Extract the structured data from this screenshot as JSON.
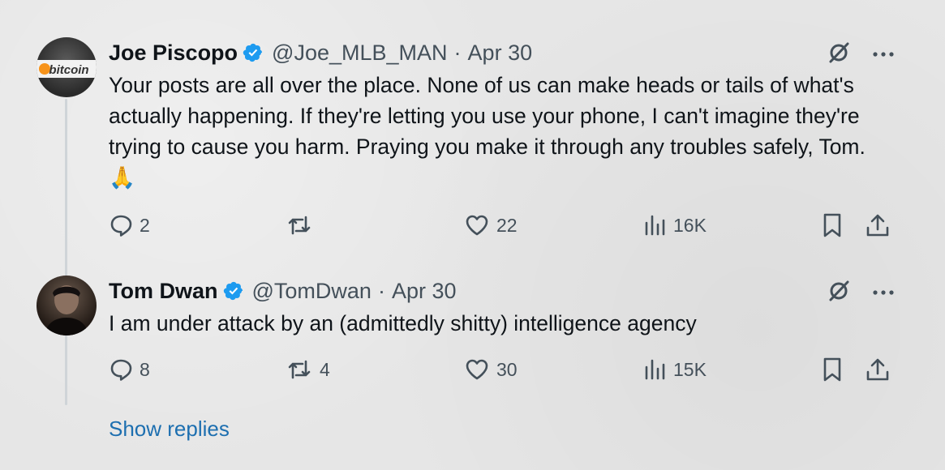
{
  "tweets": [
    {
      "author": {
        "name": "Joe Piscopo",
        "handle": "@Joe_MLB_MAN",
        "avatar_text": "bitcoin",
        "verified": true
      },
      "date": "Apr 30",
      "separator": "·",
      "text": "Your posts are all over the place. None of us can make heads or tails of what's actually happening. If they're letting you use your phone, I can't imagine they're trying to cause you harm. Praying you make it through any troubles safely, Tom. 🙏",
      "stats": {
        "replies": "2",
        "reposts": "",
        "likes": "22",
        "views": "16K"
      }
    },
    {
      "author": {
        "name": "Tom Dwan",
        "handle": "@TomDwan",
        "verified": true
      },
      "date": "Apr 30",
      "separator": "·",
      "text": "I am under attack by an (admittedly shitty) intelligence agency",
      "stats": {
        "replies": "8",
        "reposts": "4",
        "likes": "30",
        "views": "15K"
      }
    }
  ],
  "show_replies_label": "Show replies",
  "icons": {
    "reply": "reply-icon",
    "repost": "repost-icon",
    "like": "heart-icon",
    "views": "views-icon",
    "bookmark": "bookmark-icon",
    "share": "share-icon",
    "grok": "grok-icon",
    "more": "more-icon",
    "verified": "verified-badge-icon"
  },
  "colors": {
    "background": "#e6e6e6",
    "text": "#0f1419",
    "secondary": "#44505a",
    "verified": "#1d9bf0",
    "link": "#1d6fb0"
  }
}
